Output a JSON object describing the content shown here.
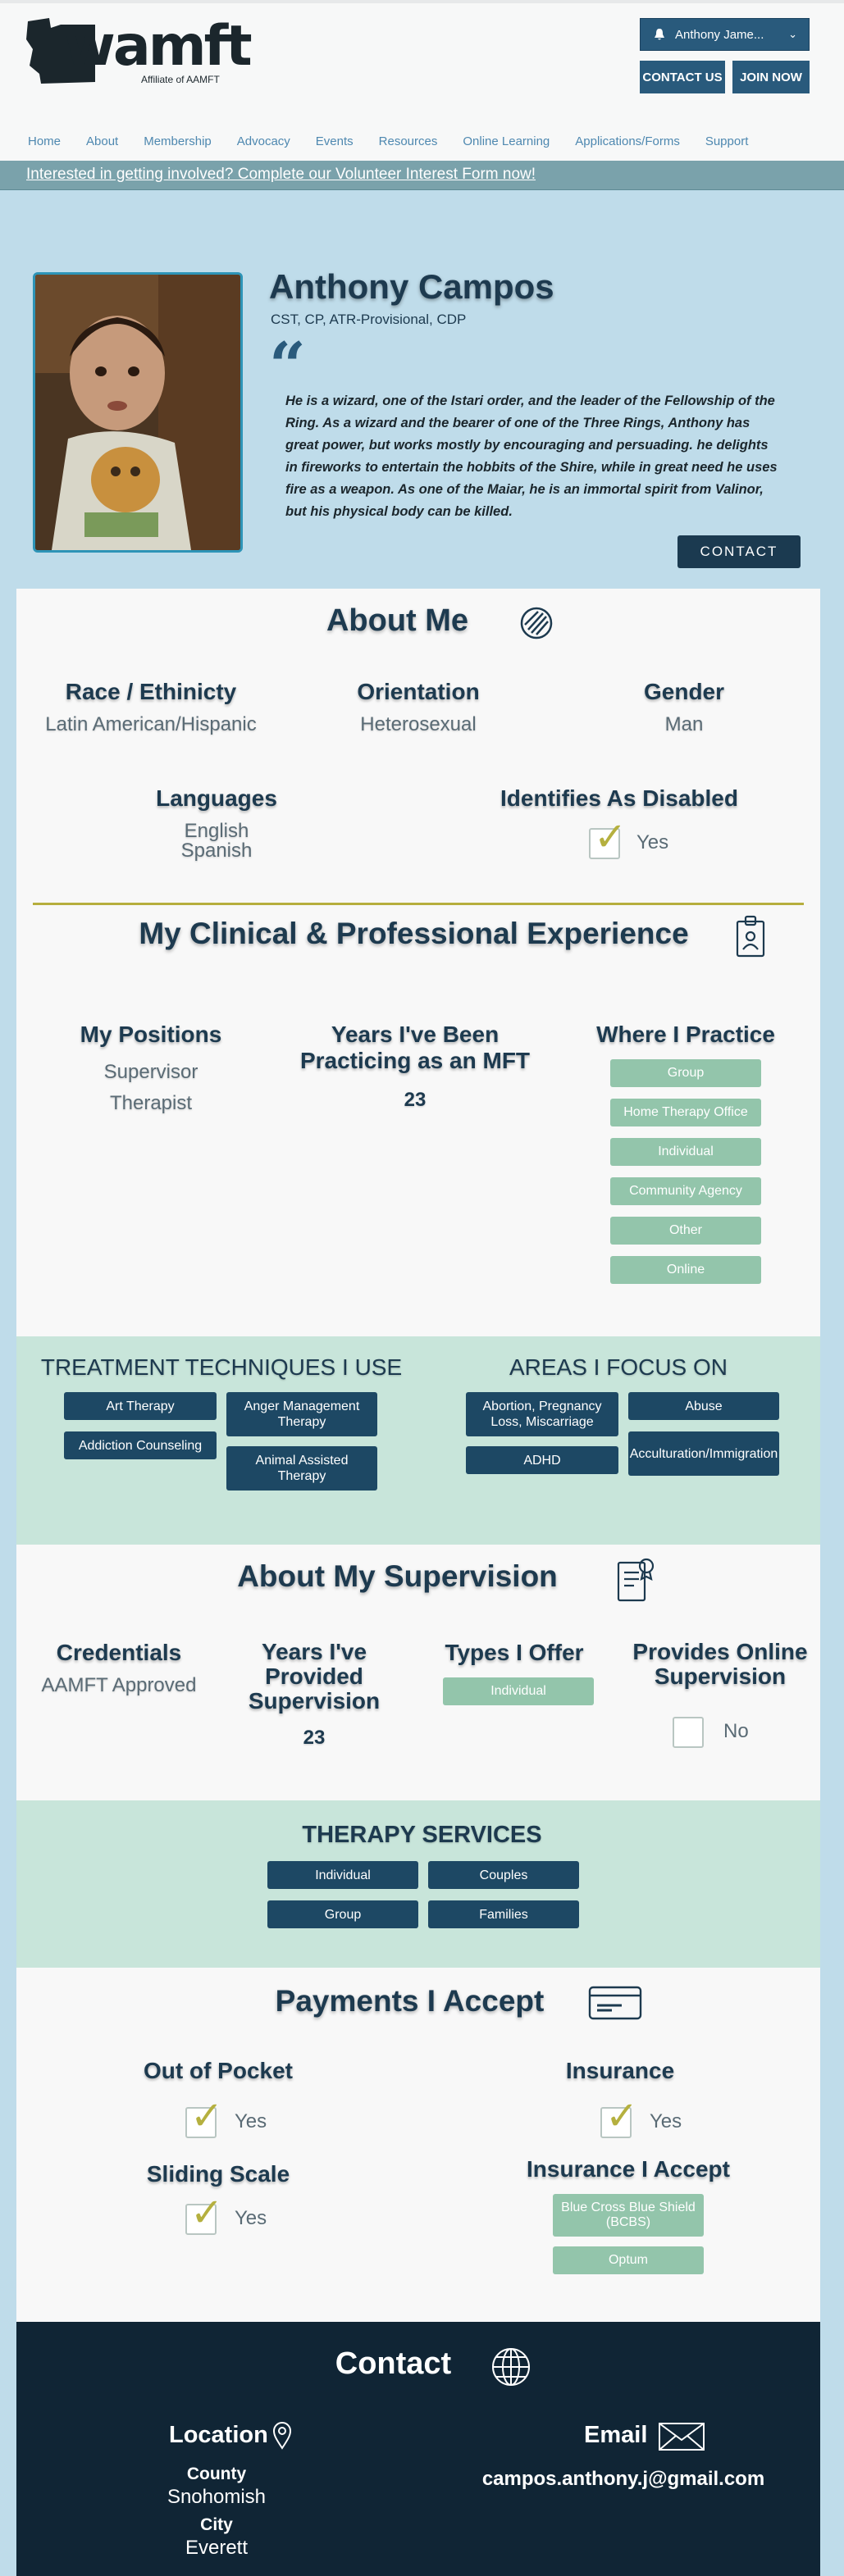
{
  "header": {
    "logo_text": "wamft",
    "logo_tagline": "Affiliate of AAMFT",
    "user_name": "Anthony Jame...",
    "contact_button": "CONTACT US",
    "join_button": "JOIN NOW",
    "nav": [
      "Home",
      "About",
      "Membership",
      "Advocacy",
      "Events",
      "Resources",
      "Online Learning",
      "Applications/Forms",
      "Support"
    ]
  },
  "banner": {
    "text": "Interested in getting involved? Complete our Volunteer Interest Form now!"
  },
  "profile": {
    "name": "Anthony Campos",
    "credentials": "CST, CP, ATR-Provisional, CDP",
    "quote_mark": "“",
    "bio": "He is a wizard, one of the Istari order, and the leader of the Fellowship of the Ring. As a wizard and the bearer of one of the Three Rings, Anthony has great power, but works mostly by encouraging and persuading. he delights in fireworks to entertain the hobbits of the Shire, while in great need he uses fire as a weapon. As one of the Maiar, he is an immortal spirit from Valinor, but his physical body can be killed.",
    "contact_button": "CONTACT"
  },
  "about": {
    "title": "About Me",
    "race_label": "Race / Ethinicty",
    "race_value": "Latin American/Hispanic",
    "orientation_label": "Orientation",
    "orientation_value": "Heterosexual",
    "gender_label": "Gender",
    "gender_value": "Man",
    "languages_label": "Languages",
    "languages": [
      "English",
      "Spanish"
    ],
    "disabled_label": "Identifies As Disabled",
    "disabled_value": "Yes"
  },
  "experience": {
    "title": "My Clinical & Professional Experience",
    "positions_label": "My Positions",
    "positions": [
      "Supervisor",
      "Therapist"
    ],
    "years_label": "Years I've Been Practicing as an MFT",
    "years_value": "23",
    "practice_label": "Where I Practice",
    "practice": [
      "Group",
      "Home Therapy Office",
      "Individual",
      "Community Agency",
      "Other",
      "Online"
    ]
  },
  "techniques": {
    "title": "TREATMENT TECHNIQUES I USE",
    "items": [
      "Art Therapy",
      "Anger Management Therapy",
      "Addiction Counseling",
      "Animal Assisted Therapy"
    ]
  },
  "focus": {
    "title": "AREAS I FOCUS ON",
    "items": [
      "Abortion, Pregnancy Loss, Miscarriage",
      "Abuse",
      "ADHD",
      "Acculturation/Immigration"
    ]
  },
  "supervision": {
    "title": "About My Supervision",
    "credentials_label": "Credentials",
    "credentials_value": "AAMFT Approved",
    "years_label": "Years I've Provided Supervision",
    "years_value": "23",
    "types_label": "Types I Offer",
    "types": [
      "Individual"
    ],
    "online_label": "Provides Online Supervision",
    "online_value": "No"
  },
  "services": {
    "title": "THERAPY SERVICES",
    "items": [
      "Individual",
      "Couples",
      "Group",
      "Families"
    ]
  },
  "payments": {
    "title": "Payments I Accept",
    "out_of_pocket_label": "Out of Pocket",
    "out_of_pocket_value": "Yes",
    "insurance_label": "Insurance",
    "insurance_value": "Yes",
    "sliding_label": "Sliding Scale",
    "sliding_value": "Yes",
    "insurance_accept_label": "Insurance I Accept",
    "insurance_accept": [
      "Blue Cross Blue Shield (BCBS)",
      "Optum"
    ]
  },
  "contact": {
    "title": "Contact",
    "location_label": "Location",
    "county_label": "County",
    "county_value": "Snohomish",
    "city_label": "City",
    "city_value": "Everett",
    "email_label": "Email",
    "email_value": "campos.anthony.j@gmail.com"
  },
  "colors": {
    "accent": "#295a7c",
    "mint": "#c8e5da",
    "pill_green": "#93c5ab",
    "check": "#b5b03f",
    "footer": "#102535"
  }
}
